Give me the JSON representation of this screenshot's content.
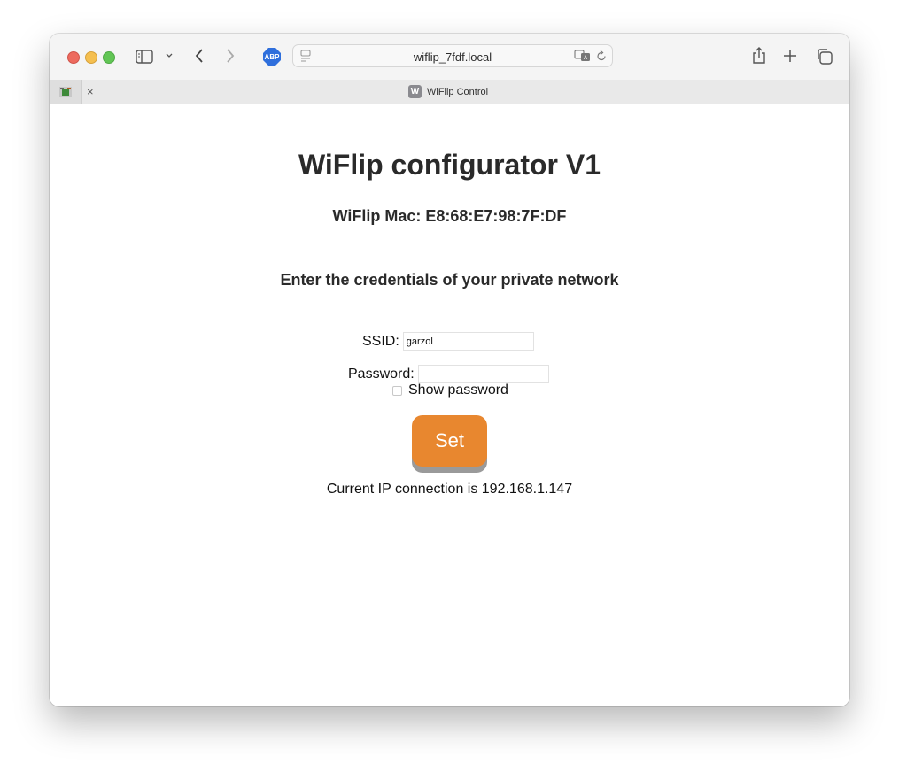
{
  "browser": {
    "url": "wiflip_7fdf.local",
    "tab_title": "WiFlip Control",
    "tab_favicon_letter": "W",
    "tab_close": "×",
    "adblock_label": "ABP"
  },
  "page": {
    "title": "WiFlip configurator V1",
    "mac_line": "WiFlip Mac: E8:68:E7:98:7F:DF",
    "prompt": "Enter the credentials of your private network",
    "ssid_label": "SSID:",
    "ssid_value": "garzol",
    "password_label": "Password:",
    "password_value": "",
    "show_password_label": "Show password",
    "show_password_checked": false,
    "set_button": "Set",
    "status": "Current IP connection is 192.168.1.147"
  },
  "colors": {
    "accent_button": "#e8872f",
    "abp_badge": "#2f6fdc"
  }
}
